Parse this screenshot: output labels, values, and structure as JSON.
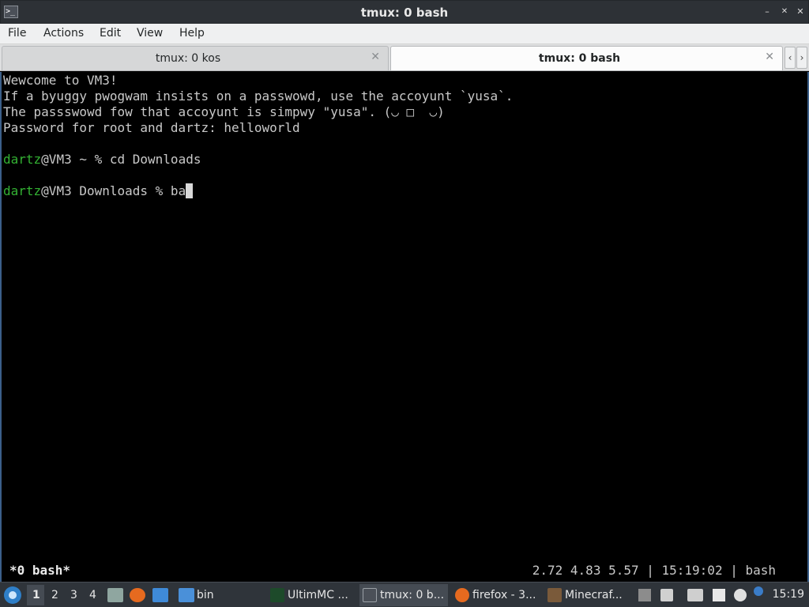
{
  "window": {
    "title": "tmux: 0 bash",
    "minimize_glyph": "–",
    "maximize_glyph": "✕",
    "close_glyph": "✕"
  },
  "menu": [
    "File",
    "Actions",
    "Edit",
    "View",
    "Help"
  ],
  "tabs": [
    {
      "label": "tmux: 0 kos",
      "active": false
    },
    {
      "label": "tmux: 0 bash",
      "active": true
    }
  ],
  "tab_nav": {
    "prev": "‹",
    "next": "›"
  },
  "terminal": {
    "motd": [
      "Wewcome to VM3!",
      "If a byuggy pwogwam insists on a passwowd, use the accoyunt `yusa`.",
      "The passswowd fow that accoyunt is simpwy \"yusa\". (◡ □  ◡)",
      "Password for root and dartz: helloworld"
    ],
    "prompt1": {
      "user": "dartz",
      "rest": "@VM3 ~ % cd Downloads"
    },
    "prompt2": {
      "user": "dartz",
      "rest": "@VM3 Downloads % ba"
    },
    "status_left": "*0 bash*",
    "status_right": "2.72 4.83 5.57 | 15:19:02 | bash"
  },
  "taskbar": {
    "workspaces": [
      "1",
      "2",
      "3",
      "4"
    ],
    "active_workspace": "1",
    "folder_label": "bin",
    "tasks": [
      {
        "label": "UltimMC ...",
        "icon": "ultimmc-icon",
        "active": false
      },
      {
        "label": "tmux: 0 b...",
        "icon": "terminal-icon",
        "active": true
      },
      {
        "label": "firefox - 3...",
        "icon": "firefox-icon",
        "active": false
      },
      {
        "label": "Minecraf...",
        "icon": "minecraft-icon",
        "active": false
      }
    ],
    "clock": "15:19"
  },
  "colors": {
    "titlebar": "#2d3136",
    "prompt_user": "#33b233",
    "terminal_bg": "#000000",
    "taskbar": "#2f343a"
  }
}
